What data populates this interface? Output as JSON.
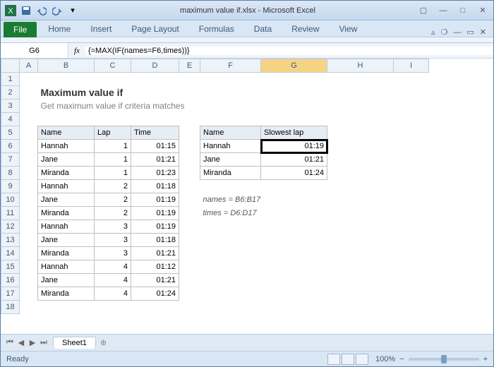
{
  "window": {
    "title": "maximum value if.xlsx - Microsoft Excel"
  },
  "ribbon": {
    "file": "File",
    "tabs": [
      "Home",
      "Insert",
      "Page Layout",
      "Formulas",
      "Data",
      "Review",
      "View"
    ]
  },
  "formula_bar": {
    "namebox": "G6",
    "formula": "{=MAX(IF(names=F6,times))}"
  },
  "columns": [
    "A",
    "B",
    "C",
    "D",
    "E",
    "F",
    "G",
    "H",
    "I"
  ],
  "rows_visible": [
    "1",
    "2",
    "3",
    "4",
    "5",
    "6",
    "7",
    "8",
    "9",
    "10",
    "11",
    "12",
    "13",
    "14",
    "15",
    "16",
    "17",
    "18"
  ],
  "selected_col": "G",
  "sheet": {
    "title": "Maximum value if",
    "subtitle": "Get maximum value if criteria matches",
    "table1_headers": {
      "name": "Name",
      "lap": "Lap",
      "time": "Time"
    },
    "table1": [
      {
        "name": "Hannah",
        "lap": "1",
        "time": "01:15"
      },
      {
        "name": "Jane",
        "lap": "1",
        "time": "01:21"
      },
      {
        "name": "Miranda",
        "lap": "1",
        "time": "01:23"
      },
      {
        "name": "Hannah",
        "lap": "2",
        "time": "01:18"
      },
      {
        "name": "Jane",
        "lap": "2",
        "time": "01:19"
      },
      {
        "name": "Miranda",
        "lap": "2",
        "time": "01:19"
      },
      {
        "name": "Hannah",
        "lap": "3",
        "time": "01:19"
      },
      {
        "name": "Jane",
        "lap": "3",
        "time": "01:18"
      },
      {
        "name": "Miranda",
        "lap": "3",
        "time": "01:21"
      },
      {
        "name": "Hannah",
        "lap": "4",
        "time": "01:12"
      },
      {
        "name": "Jane",
        "lap": "4",
        "time": "01:21"
      },
      {
        "name": "Miranda",
        "lap": "4",
        "time": "01:24"
      }
    ],
    "table2_headers": {
      "name": "Name",
      "slowest": "Slowest lap"
    },
    "table2": [
      {
        "name": "Hannah",
        "slowest": "01:19"
      },
      {
        "name": "Jane",
        "slowest": "01:21"
      },
      {
        "name": "Miranda",
        "slowest": "01:24"
      }
    ],
    "notes": [
      "names = B6:B17",
      "times = D6:D17"
    ]
  },
  "sheet_tabs": {
    "active": "Sheet1"
  },
  "statusbar": {
    "status": "Ready",
    "zoom": "100%"
  }
}
